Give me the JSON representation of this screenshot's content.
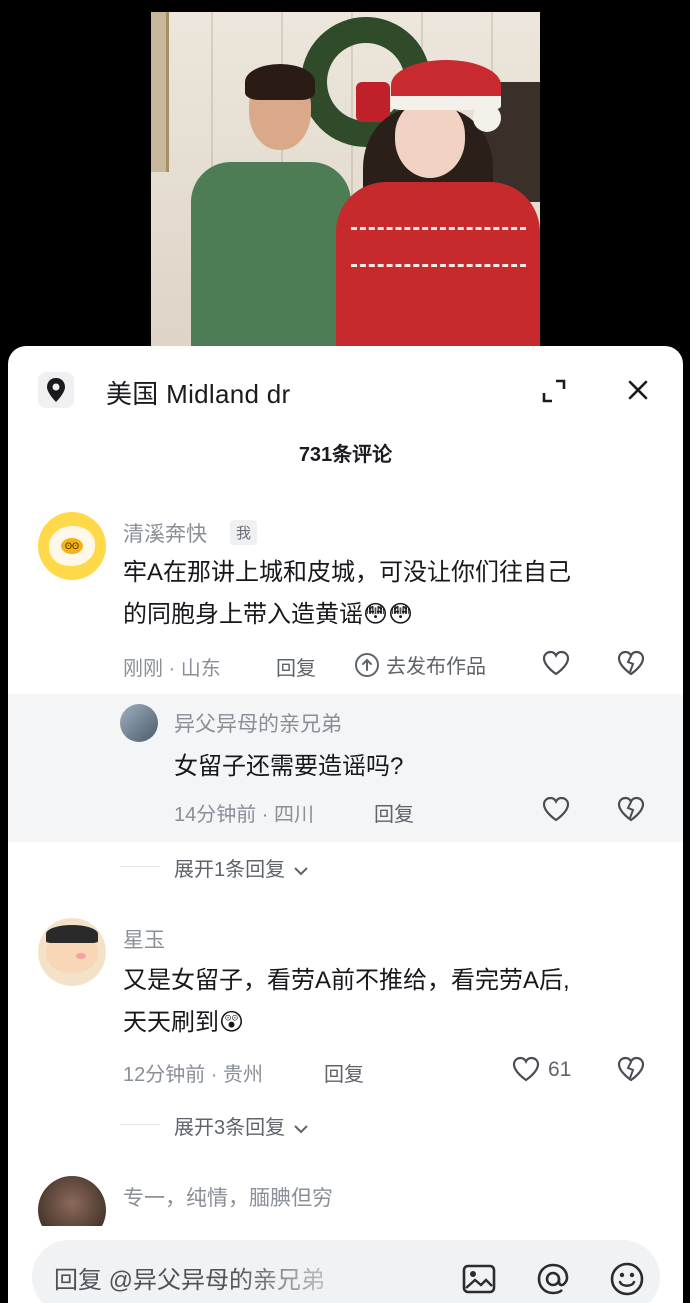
{
  "location": {
    "text": "美国  Midland dr"
  },
  "comment_count_label": "731条评论",
  "comments": [
    {
      "username": "清溪奔快",
      "tag": "我",
      "text_line1": "牢A在那讲上城和皮城，可没让你们往自己",
      "text_line2": "的同胞身上带入造黄谣😳😳",
      "time": "刚刚 · 山东",
      "reply_label": "回复",
      "publish_label": "去发布作品",
      "reply": {
        "username": "异父异母的亲兄弟",
        "text": "女留子还需要造谣吗?",
        "time": "14分钟前 · 四川",
        "reply_label": "回复"
      },
      "expand_label": "展开1条回复"
    },
    {
      "username": "星玉",
      "text_line1": "又是女留子，看劳A前不推给，看完劳A后,",
      "text_line2": "天天刷到😲",
      "time": "12分钟前 · 贵州",
      "reply_label": "回复",
      "likes": "61",
      "expand_label": "展开3条回复"
    },
    {
      "username": "专一，纯情，腼腆但穷"
    }
  ],
  "input": {
    "text": "回复 @异父异母的亲兄弟"
  },
  "icons": {
    "location": "location-pin-icon",
    "expand": "expand-icon",
    "close": "close-icon",
    "heart": "heart-icon",
    "broken_heart": "broken-heart-icon",
    "image": "image-icon",
    "at": "at-icon",
    "emoji": "emoji-icon"
  }
}
